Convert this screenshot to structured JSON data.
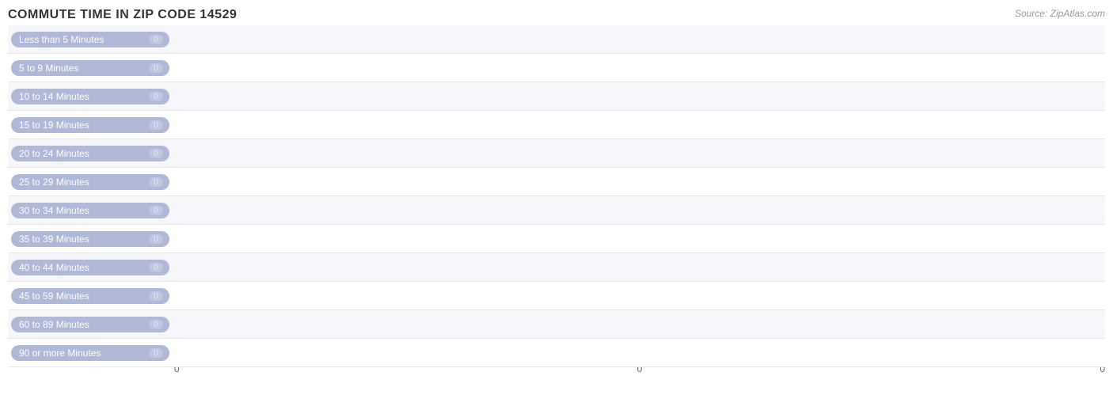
{
  "title": "COMMUTE TIME IN ZIP CODE 14529",
  "source": "Source: ZipAtlas.com",
  "x_axis_labels": [
    "0",
    "0",
    "0"
  ],
  "rows": [
    {
      "label": "Less than 5 Minutes",
      "value": 0
    },
    {
      "label": "5 to 9 Minutes",
      "value": 0
    },
    {
      "label": "10 to 14 Minutes",
      "value": 0
    },
    {
      "label": "15 to 19 Minutes",
      "value": 0
    },
    {
      "label": "20 to 24 Minutes",
      "value": 0
    },
    {
      "label": "25 to 29 Minutes",
      "value": 0
    },
    {
      "label": "30 to 34 Minutes",
      "value": 0
    },
    {
      "label": "35 to 39 Minutes",
      "value": 0
    },
    {
      "label": "40 to 44 Minutes",
      "value": 0
    },
    {
      "label": "45 to 59 Minutes",
      "value": 0
    },
    {
      "label": "60 to 89 Minutes",
      "value": 0
    },
    {
      "label": "90 or more Minutes",
      "value": 0
    }
  ]
}
